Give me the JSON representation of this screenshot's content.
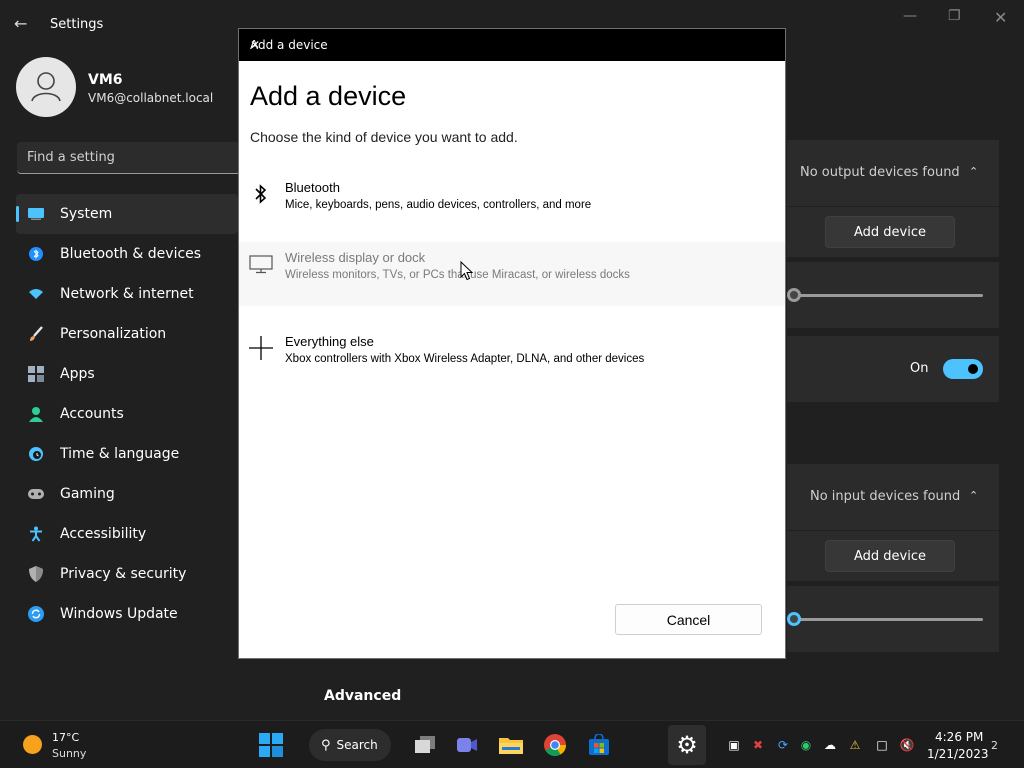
{
  "settings": {
    "app_title": "Settings",
    "profile": {
      "name": "VM6",
      "email": "VM6@collabnet.local"
    },
    "search_placeholder": "Find a setting",
    "nav": [
      {
        "label": "System",
        "icon": "monitor-icon",
        "color": "#4cc2ff"
      },
      {
        "label": "Bluetooth & devices",
        "icon": "bluetooth-icon",
        "color": "#1e90ff"
      },
      {
        "label": "Network & internet",
        "icon": "wifi-icon",
        "color": "#4cc2ff"
      },
      {
        "label": "Personalization",
        "icon": "brush-icon",
        "color": "#f0a060"
      },
      {
        "label": "Apps",
        "icon": "apps-icon",
        "color": "#a0b0c0"
      },
      {
        "label": "Accounts",
        "icon": "person-icon",
        "color": "#2ecc9a"
      },
      {
        "label": "Time & language",
        "icon": "clock-globe-icon",
        "color": "#4cc2ff"
      },
      {
        "label": "Gaming",
        "icon": "gamepad-icon",
        "color": "#b0b0b0"
      },
      {
        "label": "Accessibility",
        "icon": "accessibility-icon",
        "color": "#4cc2ff"
      },
      {
        "label": "Privacy & security",
        "icon": "shield-icon",
        "color": "#b0b0b0"
      },
      {
        "label": "Windows Update",
        "icon": "update-icon",
        "color": "#2a9df4"
      }
    ],
    "output": {
      "status": "No output devices found",
      "add_label": "Add device"
    },
    "toggle_label": "On",
    "input": {
      "status": "No input devices found",
      "add_label": "Add device"
    },
    "advanced_label": "Advanced"
  },
  "dialog": {
    "title_bar": "Add a device",
    "heading": "Add a device",
    "subtitle": "Choose the kind of device you want to add.",
    "options": [
      {
        "title": "Bluetooth",
        "desc": "Mice, keyboards, pens, audio devices, controllers, and more",
        "icon": "bluetooth-icon"
      },
      {
        "title": "Wireless display or dock",
        "desc": "Wireless monitors, TVs, or PCs that use Miracast, or wireless docks",
        "icon": "monitor-icon"
      },
      {
        "title": "Everything else",
        "desc": "Xbox controllers with Xbox Wireless Adapter, DLNA, and other devices",
        "icon": "plus-icon"
      }
    ],
    "cancel_label": "Cancel"
  },
  "taskbar": {
    "weather": {
      "temp": "17°C",
      "condition": "Sunny"
    },
    "search_label": "Search",
    "clock": {
      "time": "4:26 PM",
      "date": "1/21/2023"
    },
    "notification_count": "2"
  }
}
